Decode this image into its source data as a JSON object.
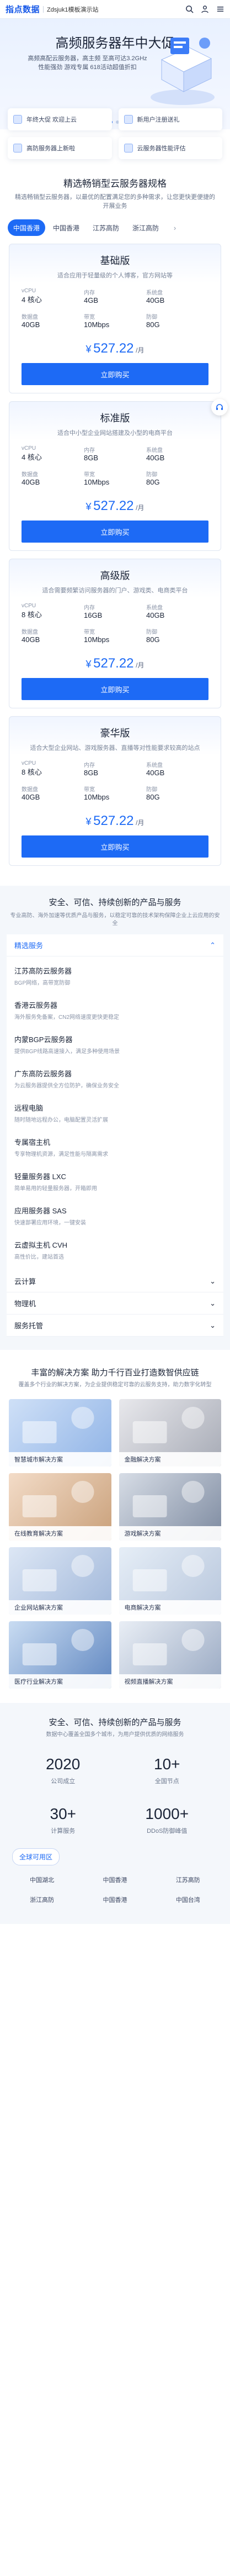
{
  "header": {
    "logo": "指点数据",
    "site_name": "Zdsjuk1模板演示站",
    "icons": [
      "search-icon",
      "user-icon",
      "menu-icon"
    ]
  },
  "hero": {
    "title": "高频服务器年中大促",
    "desc": "高频高配云服务器，高主频 至高可达3.2GHz 性能强劲 游戏专属 618活动超值折扣"
  },
  "features": [
    {
      "label": "年终大促 欢迎上云",
      "icon": "cloud-icon"
    },
    {
      "label": "新用户注册送礼",
      "icon": "gift-icon"
    },
    {
      "label": "高防服务器上新啦",
      "icon": "shield-icon"
    },
    {
      "label": "云服务器性能评估",
      "icon": "chart-icon"
    }
  ],
  "pricing": {
    "title": "精选畅销型云服务器规格",
    "subtitle": "精选畅销型云服务器，以最优的配置满足您的多种需求，让您更快更便捷的开展业务",
    "tabs": [
      "中国香港",
      "中国香港",
      "江苏高防",
      "浙江高防"
    ],
    "active_tab": 0,
    "spec_keys": {
      "cpu": "vCPU",
      "mem": "内存",
      "disk": "系统盘",
      "data": "数据盘",
      "bw": "带宽",
      "def": "防御"
    },
    "currency": "¥",
    "unit": "/月",
    "buy_label": "立即购买",
    "plans": [
      {
        "name": "基础版",
        "desc": "适合应用于轻量级的个人博客，官方网站等",
        "cpu": "4 核心",
        "mem": "4GB",
        "disk": "40GB",
        "data": "40GB",
        "bw": "10Mbps",
        "def": "80G",
        "price": "527.22"
      },
      {
        "name": "标准版",
        "desc": "适合中小型企业网站搭建及小型的电商平台",
        "cpu": "4 核心",
        "mem": "8GB",
        "disk": "40GB",
        "data": "40GB",
        "bw": "10Mbps",
        "def": "80G",
        "price": "527.22"
      },
      {
        "name": "高级版",
        "desc": "适合需要频繁访问服务器的门户、游戏类、电商类平台",
        "cpu": "8 核心",
        "mem": "16GB",
        "disk": "40GB",
        "data": "40GB",
        "bw": "10Mbps",
        "def": "80G",
        "price": "527.22"
      },
      {
        "name": "豪华版",
        "desc": "适合大型企业网站、游戏服务器、直播等对性能要求较高的站点",
        "cpu": "8 核心",
        "mem": "8GB",
        "disk": "40GB",
        "data": "40GB",
        "bw": "10Mbps",
        "def": "80G",
        "price": "527.22"
      }
    ]
  },
  "products": {
    "title": "安全、可信、持续创新的产品与服务",
    "subtitle": "专业高防、海外加速等优质产品与服务，以稳定可靠的技术架构保障企业上云应用的安全",
    "sections": [
      {
        "label": "精选服务",
        "open": true
      },
      {
        "label": "云计算",
        "open": false
      },
      {
        "label": "物理机",
        "open": false
      },
      {
        "label": "服务托管",
        "open": false
      }
    ],
    "items": [
      {
        "name": "江苏高防云服务器",
        "desc": "BGP网络，高带宽防御"
      },
      {
        "name": "香港云服务器",
        "desc": "海外服务免备案，CN2网络速度更快更稳定"
      },
      {
        "name": "内蒙BGP云服务器",
        "desc": "提供BGP线路高速接入，满足多种使用场景"
      },
      {
        "name": "广东高防云服务器",
        "desc": "为云服务器提供全方位防护，确保业务安全"
      },
      {
        "name": "远程电脑",
        "desc": "随时随地远程办公，电脑配置灵活扩展"
      },
      {
        "name": "专属宿主机",
        "desc": "专享物理机资源，满足性能与隔离需求"
      },
      {
        "name": "轻量服务器 LXC",
        "desc": "简单易用的轻量服务器，开箱即用"
      },
      {
        "name": "应用服务器 SAS",
        "desc": "快速部署应用环境，一键安装"
      },
      {
        "name": "云虚拟主机 CVH",
        "desc": "高性价比，建站首选"
      }
    ]
  },
  "solutions": {
    "title": "丰富的解决方案 助力千行百业打造数智供应链",
    "subtitle": "覆盖多个行业的解决方案，为企业提供稳定可靠的云服务支持，助力数字化转型",
    "cards": [
      {
        "label": "智慧城市解决方案"
      },
      {
        "label": "金融解决方案"
      },
      {
        "label": "在线教育解决方案"
      },
      {
        "label": "游戏解决方案"
      },
      {
        "label": "企业网站解决方案"
      },
      {
        "label": "电商解决方案"
      },
      {
        "label": "医疗行业解决方案"
      },
      {
        "label": "视频直播解决方案"
      }
    ]
  },
  "stats": {
    "title": "安全、可信、持续创新的产品与服务",
    "subtitle": "数据中心覆盖全国多个城市，为用户提供优质的网络服务",
    "items": [
      {
        "num": "2020",
        "label": "公司成立"
      },
      {
        "num": "10+",
        "label": "全国节点"
      },
      {
        "num": "30+",
        "label": "计算服务"
      },
      {
        "num": "1000+",
        "label": "DDoS防御峰值"
      }
    ],
    "node_title": "全球可用区",
    "nodes": [
      "中国湖北",
      "中国香港",
      "江苏高防",
      "浙江高防",
      "中国香港",
      "中国台湾"
    ]
  },
  "colors": {
    "accent": "#1d6af5",
    "text": "#1b2437"
  }
}
